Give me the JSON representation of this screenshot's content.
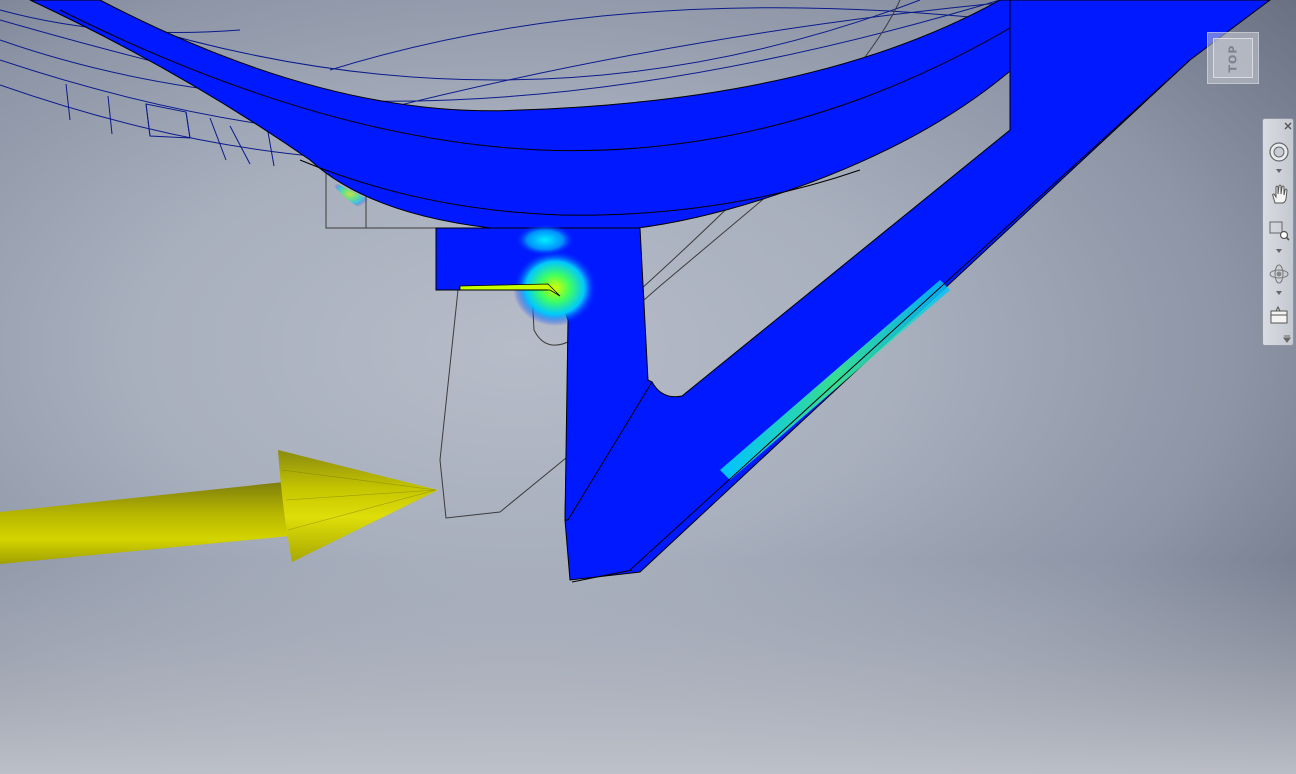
{
  "viewcube": {
    "face_label": "TOP"
  },
  "navigation_bar": {
    "buttons": [
      {
        "icon": "full-navigation-wheel-icon",
        "has_dropdown": true
      },
      {
        "icon": "pan-hand-icon",
        "has_dropdown": false
      },
      {
        "icon": "zoom-window-icon",
        "has_dropdown": true
      },
      {
        "icon": "orbit-icon",
        "has_dropdown": true
      },
      {
        "icon": "look-at-icon",
        "has_dropdown": false
      }
    ]
  },
  "colors": {
    "stress_low": "#0019ff",
    "stress_mid": "#00e0ff",
    "stress_high": "#c8ff00",
    "load_arrow": "#d4d400",
    "wireframe": "#0a1a8c"
  }
}
